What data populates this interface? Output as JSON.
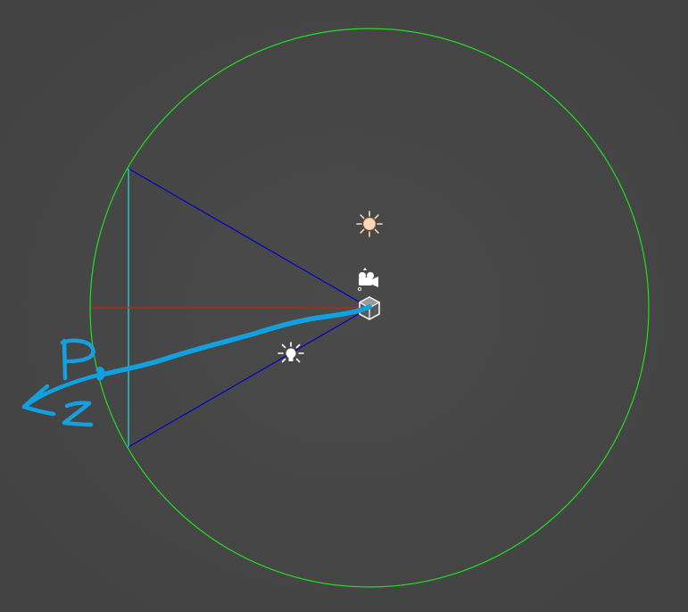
{
  "scene": {
    "background": "#454545",
    "icons": {
      "sun_light": "sun-icon",
      "camera": "camera-icon",
      "object_origin": "cube-icon",
      "point_light": "point-light-icon"
    },
    "colors": {
      "bounding_circle": "#1fe01f",
      "frustum_edges": "#0000c8",
      "frustum_far_plane": "#21d0e0",
      "view_axis": "#c81e1e",
      "annotation": "#12a0e0",
      "icon": "#ffffff",
      "sun": "#ffd9b5"
    }
  },
  "annotation": {
    "point_label": "P",
    "axis_label": "Z"
  }
}
